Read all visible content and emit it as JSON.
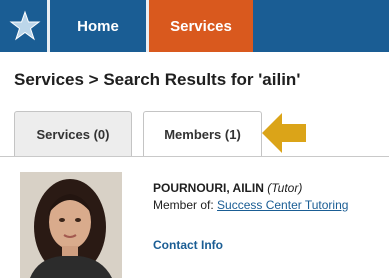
{
  "nav": {
    "items": [
      {
        "label": "Home"
      },
      {
        "label": "Services"
      }
    ],
    "logo_icon": "star-logo-icon",
    "colors": {
      "bar": "#1a5d94",
      "active": "#d9591e"
    }
  },
  "page": {
    "title": "Services > Search Results for 'ailin'"
  },
  "tabs": [
    {
      "label": "Services (0)",
      "active": false
    },
    {
      "label": "Members (1)",
      "active": true
    }
  ],
  "annotation": {
    "icon": "arrow-left-icon",
    "color": "#dba418"
  },
  "result": {
    "name": "POURNOURI, AILIN",
    "role": "(Tutor)",
    "member_prefix": "Member of:",
    "member_link": "Success Center Tutoring",
    "contact_label": "Contact Info",
    "avatar_icon": "profile-photo"
  }
}
